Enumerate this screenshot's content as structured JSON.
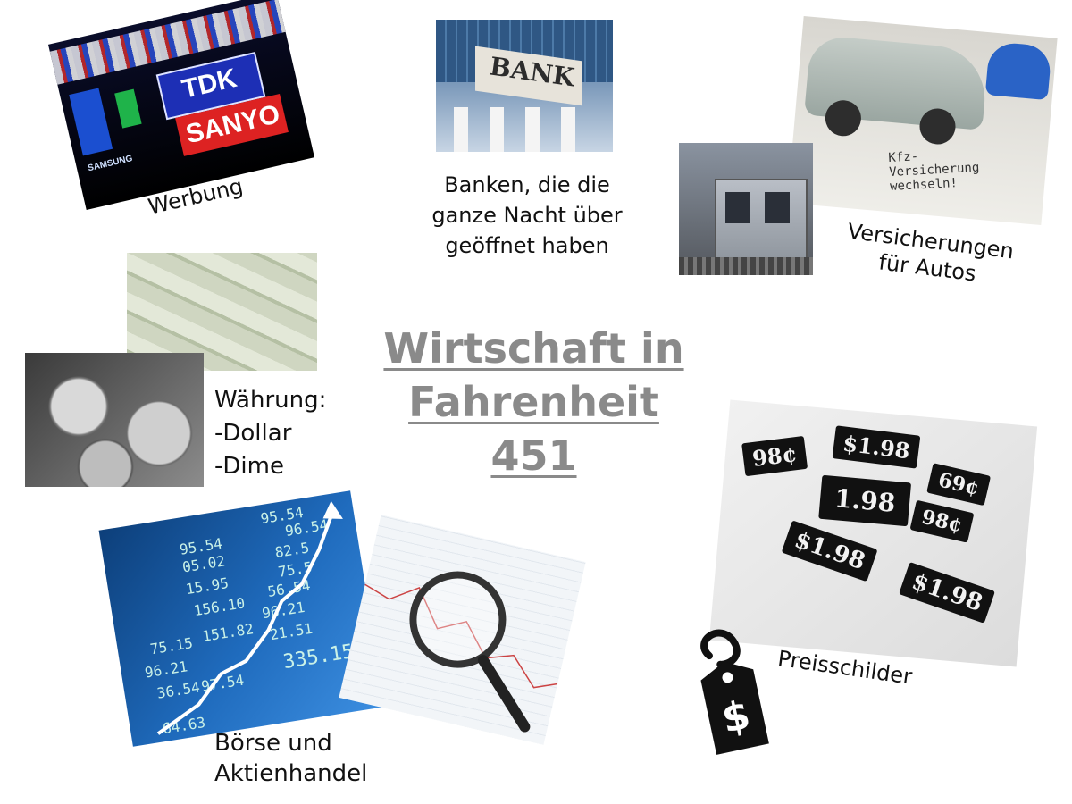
{
  "title": "Wirtschaft in Fahrenheit 451",
  "werbung": {
    "caption": "Werbung",
    "signs": [
      "TDK",
      "SANYO",
      "SAMSUNG"
    ]
  },
  "bank": {
    "sign": "BANK",
    "caption": "Banken, die die\nganze Nacht über\ngeöffnet haben"
  },
  "versicherung": {
    "note": "Kfz-\nVersicherung\nwechseln!",
    "caption": "Versicherungen\nfür Autos"
  },
  "waehrung": {
    "caption": "Währung:\n-Dollar\n-Dime"
  },
  "boerse": {
    "ticker": [
      "95.54",
      "96.54",
      "82.5",
      "75.5",
      "56.54",
      "96.21",
      "21.51",
      "335.15",
      "97.54",
      "151.82",
      "156.10",
      "15.95",
      "05.02",
      "95.54",
      "64.63",
      "36.54",
      "96.21",
      "75.15"
    ],
    "caption": "Börse und\nAktienhandel"
  },
  "preise": {
    "tags": [
      "98¢",
      "$1.98",
      "1.98",
      "69¢",
      "98¢",
      "$1.98",
      "$1.98"
    ],
    "caption": "Preisschilder"
  }
}
